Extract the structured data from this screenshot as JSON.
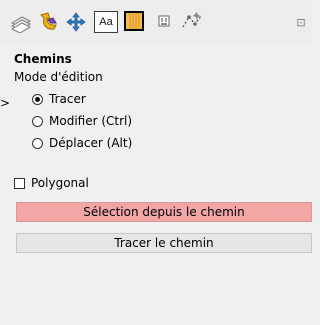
{
  "toolbar": {
    "icons": [
      "layers-icon",
      "undo-history-icon",
      "move-icon",
      "text-tool-icon",
      "paths-icon",
      "channels-icon",
      "path-editor-icon",
      "overflow-icon"
    ],
    "text_tool_label": "Aa",
    "overflow_label": "⊡"
  },
  "panel": {
    "title": "Chemins",
    "mode_label": "Mode d'édition",
    "modes": [
      "Tracer",
      "Modifier (Ctrl)",
      "Déplacer (Alt)"
    ],
    "selected_mode": "Tracer",
    "polygonal_label": "Polygonal",
    "polygonal_checked": false,
    "selection_button": "Sélection depuis le chemin",
    "trace_button": "Tracer le chemin",
    "selection_button_color": "#f3a6a6"
  },
  "marker": ">"
}
